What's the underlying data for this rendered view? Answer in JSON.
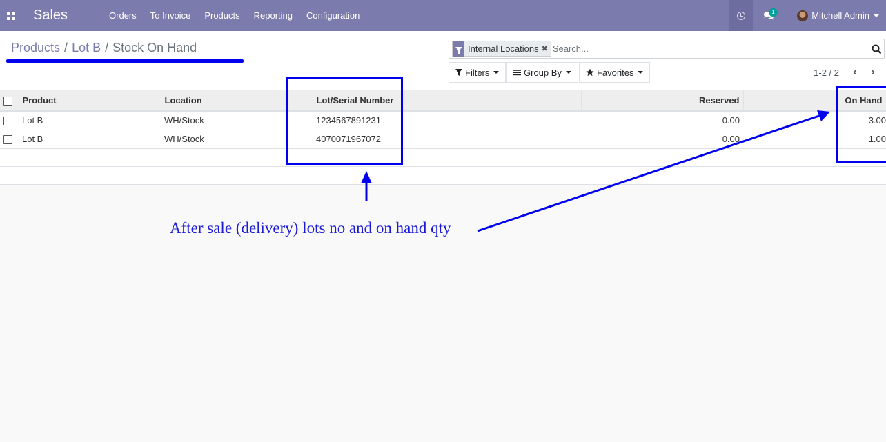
{
  "app": {
    "brand": "Sales"
  },
  "nav": {
    "menu": [
      "Orders",
      "To Invoice",
      "Products",
      "Reporting",
      "Configuration"
    ],
    "chat_badge": "1",
    "user_name": "Mitchell Admin"
  },
  "breadcrumb": {
    "items": [
      "Products",
      "Lot B"
    ],
    "current": "Stock On Hand",
    "separator": "/"
  },
  "search": {
    "facet_label": "Internal Locations",
    "facet_remove": "✖",
    "placeholder": "Search..."
  },
  "filters": {
    "filters_label": "Filters",
    "groupby_label": "Group By",
    "favorites_label": "Favorites"
  },
  "pager": {
    "value": "1-2 / 2",
    "prev": "‹",
    "next": "›"
  },
  "table": {
    "columns": [
      "Product",
      "Location",
      "Lot/Serial Number",
      "Reserved",
      "On Hand"
    ],
    "rows": [
      {
        "product": "Lot B",
        "location": "WH/Stock",
        "lot": "1234567891231",
        "reserved": "0.00",
        "on_hand": "3.00"
      },
      {
        "product": "Lot B",
        "location": "WH/Stock",
        "lot": "4070071967072",
        "reserved": "0.00",
        "on_hand": "1.00"
      }
    ]
  },
  "annotation": {
    "note": "After sale (delivery) lots no and on hand qty",
    "color": "#0000ee"
  },
  "colors": {
    "navbar": "#7c7bad",
    "accent_teal": "#00a09d"
  }
}
